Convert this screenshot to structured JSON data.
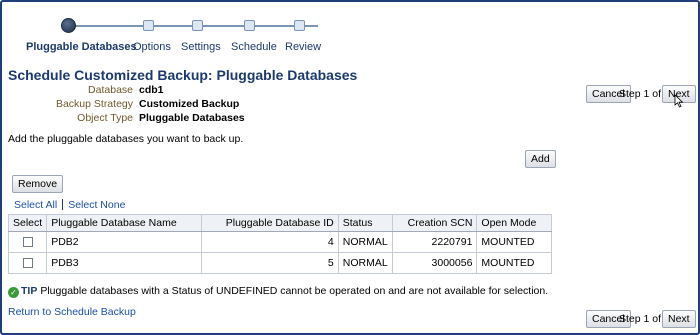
{
  "train": {
    "steps": [
      {
        "label": "Pluggable Databases",
        "current": true
      },
      {
        "label": "Options",
        "current": false
      },
      {
        "label": "Settings",
        "current": false
      },
      {
        "label": "Schedule",
        "current": false
      },
      {
        "label": "Review",
        "current": false
      }
    ]
  },
  "header": {
    "title": "Schedule Customized Backup: Pluggable Databases",
    "info": [
      {
        "label": "Database",
        "value": "cdb1"
      },
      {
        "label": "Backup Strategy",
        "value": "Customized Backup"
      },
      {
        "label": "Object Type",
        "value": "Pluggable Databases"
      }
    ]
  },
  "nav": {
    "cancel_label": "Cancel",
    "step_text": "Step 1 of 5",
    "next_label": "Next"
  },
  "instruction": "Add the pluggable databases you want to back up.",
  "add_label": "Add",
  "remove_label": "Remove",
  "select_all_label": "Select All",
  "select_none_label": "Select None",
  "table": {
    "columns": [
      "Select",
      "Pluggable Database Name",
      "Pluggable Database ID",
      "Status",
      "Creation SCN",
      "Open Mode"
    ],
    "rows": [
      {
        "name": "PDB2",
        "id": "4",
        "status": "NORMAL",
        "scn": "2220791",
        "mode": "MOUNTED",
        "checked": false
      },
      {
        "name": "PDB3",
        "id": "5",
        "status": "NORMAL",
        "scn": "3000056",
        "mode": "MOUNTED",
        "checked": false
      }
    ]
  },
  "tip": {
    "label": "TIP",
    "text": "Pluggable databases with a Status of UNDEFINED cannot be operated on and are not available for selection."
  },
  "return_link": "Return to Schedule Backup",
  "colors": {
    "title": "#1c3a6e",
    "link": "#1c4fa5",
    "info_label": "#6d5a2c",
    "frame": "#1f3f7a"
  }
}
